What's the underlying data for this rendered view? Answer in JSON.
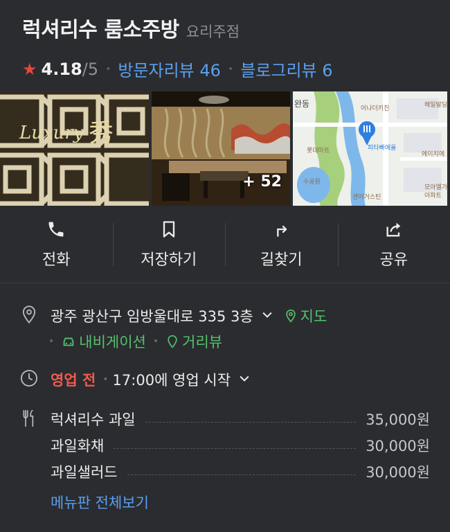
{
  "place": {
    "name": "럭셔리수 룸소주방",
    "category": "요리주점",
    "rating": "4.18",
    "rating_max": "/5",
    "visitor_reviews": "방문자리뷰 46",
    "blog_reviews": "블로그리뷰 6"
  },
  "photos": {
    "more_count": "+ 52",
    "map_labels": [
      "완동",
      "헤일발딩",
      "어나더키친",
      "롯데마트",
      "피타빠에올",
      "에이치에",
      "수공원",
      "모아엘가",
      "아파트",
      "센어거스틴"
    ]
  },
  "actions": [
    {
      "label": "전화",
      "icon": "phone-icon"
    },
    {
      "label": "저장하기",
      "icon": "bookmark-icon"
    },
    {
      "label": "길찾기",
      "icon": "directions-icon"
    },
    {
      "label": "공유",
      "icon": "share-icon"
    }
  ],
  "address": {
    "text": "광주 광산구 임방울대로 335 3층",
    "map_link": "지도",
    "navigation_link": "내비게이션",
    "streetview_link": "거리뷰"
  },
  "hours": {
    "status": "영업 전",
    "detail": "17:00에 영업 시작"
  },
  "menu": {
    "items": [
      {
        "name": "럭셔리수 과일",
        "price": "35,000원"
      },
      {
        "name": "과일화채",
        "price": "30,000원"
      },
      {
        "name": "과일샐러드",
        "price": "30,000원"
      }
    ],
    "view_all": "메뉴판 전체보기"
  },
  "colors": {
    "background": "#2b2c30",
    "link_blue": "#5aa0f0",
    "link_green": "#53c26d",
    "status_red": "#f05a4e",
    "star": "#e8453c"
  }
}
